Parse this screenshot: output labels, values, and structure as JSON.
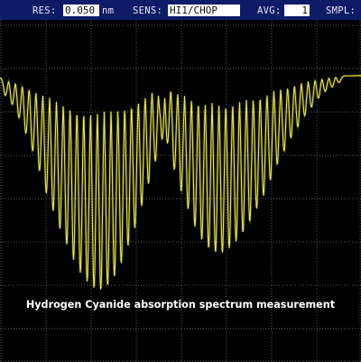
{
  "status_bar": {
    "res_label": "RES:",
    "res_value": "0.050",
    "res_unit": "nm",
    "sens_label": "SENS:",
    "sens_value": "HI1/CHOP",
    "avg_label": "AVG:",
    "avg_value": "1",
    "smpl_label": "SMPL:"
  },
  "caption": "Hydrogen Cyanide absorption spectrum measurement",
  "colors": {
    "background": "#000000",
    "status_bar": "#0e1b66",
    "grid": "#5a5a5a",
    "trace": "#e6e64a",
    "caption": "#ffffff"
  },
  "chart_data": {
    "type": "line",
    "description_of_trace": "yellow absorption spectrum with two branches of narrow dips",
    "branch_1": {
      "dip_count": 24,
      "dip_depths": [
        0.08,
        0.12,
        0.18,
        0.25,
        0.33,
        0.42,
        0.52,
        0.6,
        0.68,
        0.75,
        0.82,
        0.88,
        0.92,
        0.95,
        0.96,
        0.94,
        0.9,
        0.84,
        0.76,
        0.68,
        0.58,
        0.48,
        0.38,
        0.28
      ]
    },
    "branch_2": {
      "dip_count": 27,
      "dip_depths": [
        0.18,
        0.3,
        0.42,
        0.52,
        0.6,
        0.68,
        0.74,
        0.78,
        0.8,
        0.8,
        0.78,
        0.75,
        0.71,
        0.66,
        0.6,
        0.54,
        0.47,
        0.4,
        0.34,
        0.28,
        0.23,
        0.18,
        0.14,
        0.1,
        0.07,
        0.05,
        0.03
      ]
    }
  }
}
